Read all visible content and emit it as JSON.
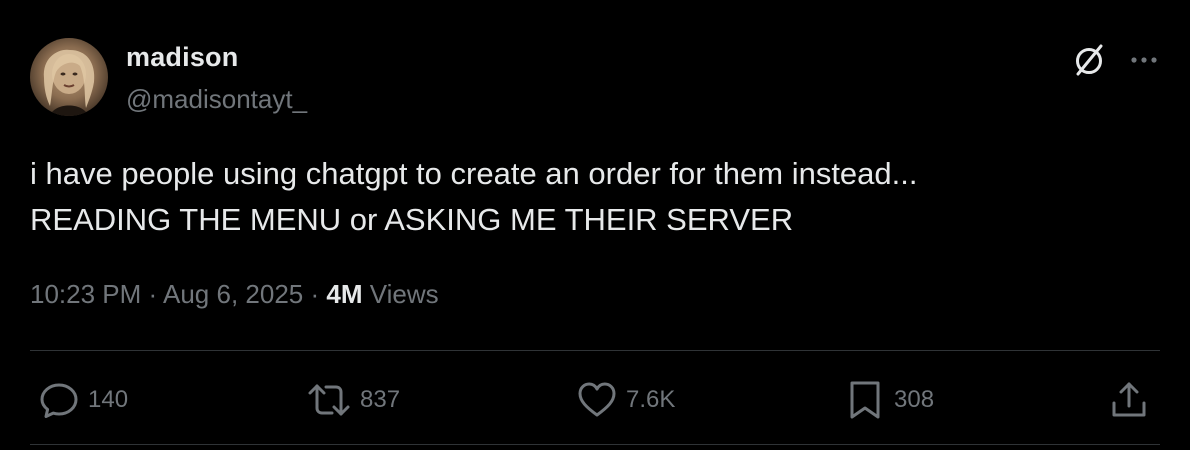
{
  "author": {
    "name": "madison",
    "handle": "@madisontayt_"
  },
  "tweet": {
    "lines": [
      "i have people using chatgpt to create an order for them instead...",
      "READING THE MENU or ASKING ME THEIR SERVER"
    ],
    "time": "10:23 PM",
    "date": "Aug 6, 2025",
    "separator": "·",
    "views_count": "4M",
    "views_label": "Views"
  },
  "actions": {
    "reply": {
      "icon": "reply-icon",
      "count": "140"
    },
    "retweet": {
      "icon": "retweet-icon",
      "count": "837"
    },
    "like": {
      "icon": "heart-icon",
      "count": "7.6K"
    },
    "bookmark": {
      "icon": "bookmark-icon",
      "count": "308"
    },
    "share": {
      "icon": "share-icon"
    }
  },
  "header_icons": [
    "grok-icon",
    "more-icon"
  ],
  "colors": {
    "background": "#000000",
    "primary_text": "#e7e9ea",
    "secondary_text": "#71767b",
    "divider": "#2f3336"
  }
}
